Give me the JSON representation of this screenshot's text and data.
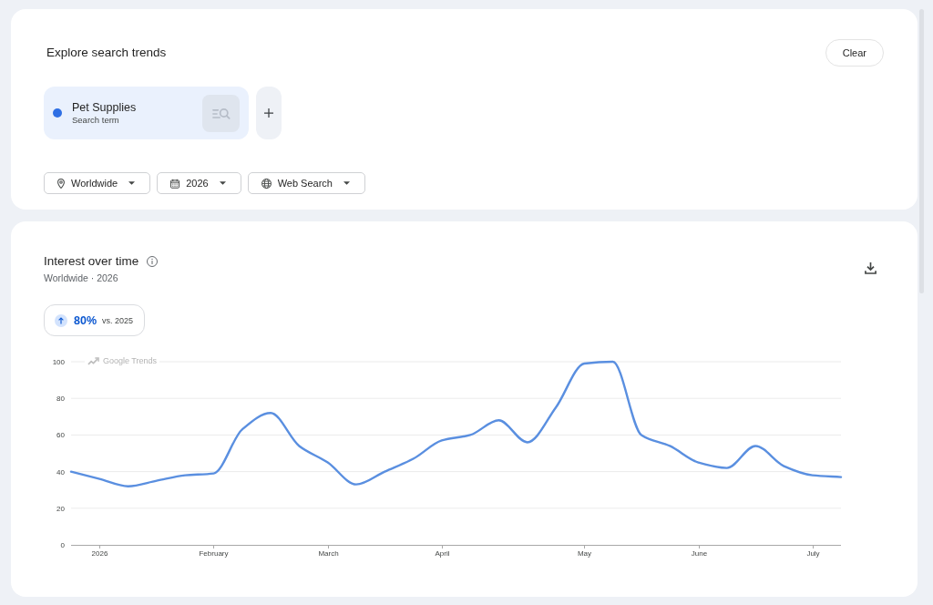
{
  "explore": {
    "title": "Explore search trends",
    "clear_button": "Clear",
    "terms": [
      {
        "label": "Pet Supplies",
        "sublabel": "Search term",
        "color": "#2f6fe4"
      }
    ],
    "filters": [
      {
        "kind": "location",
        "label": "Worldwide"
      },
      {
        "kind": "date",
        "label": "2026"
      },
      {
        "kind": "property",
        "label": "Web Search"
      }
    ]
  },
  "interest_over_time": {
    "title": "Interest over time",
    "subtitle": "Worldwide · 2026",
    "change": {
      "rising": true,
      "value": "80%",
      "comparison": "vs. 2025"
    },
    "chart_brand": "Google Trends",
    "chart_data": {
      "type": "line",
      "categories": [
        null,
        "2026",
        null,
        null,
        null,
        "February",
        null,
        null,
        null,
        "March",
        null,
        null,
        null,
        "April",
        null,
        null,
        null,
        null,
        "May",
        null,
        null,
        null,
        "June",
        null,
        null,
        null,
        "July",
        null
      ],
      "series": [
        {
          "color": "#5a8fe0",
          "values": [
            40,
            36,
            32,
            35,
            38,
            39,
            63,
            72,
            54,
            45,
            33,
            40,
            47,
            57,
            60,
            68,
            56,
            75,
            99,
            100,
            60,
            54,
            45,
            42,
            54,
            43,
            38,
            37
          ]
        }
      ],
      "ylim": [
        0,
        100
      ],
      "yticks": [
        0,
        20,
        40,
        60,
        80,
        100
      ],
      "grid": true
    }
  }
}
